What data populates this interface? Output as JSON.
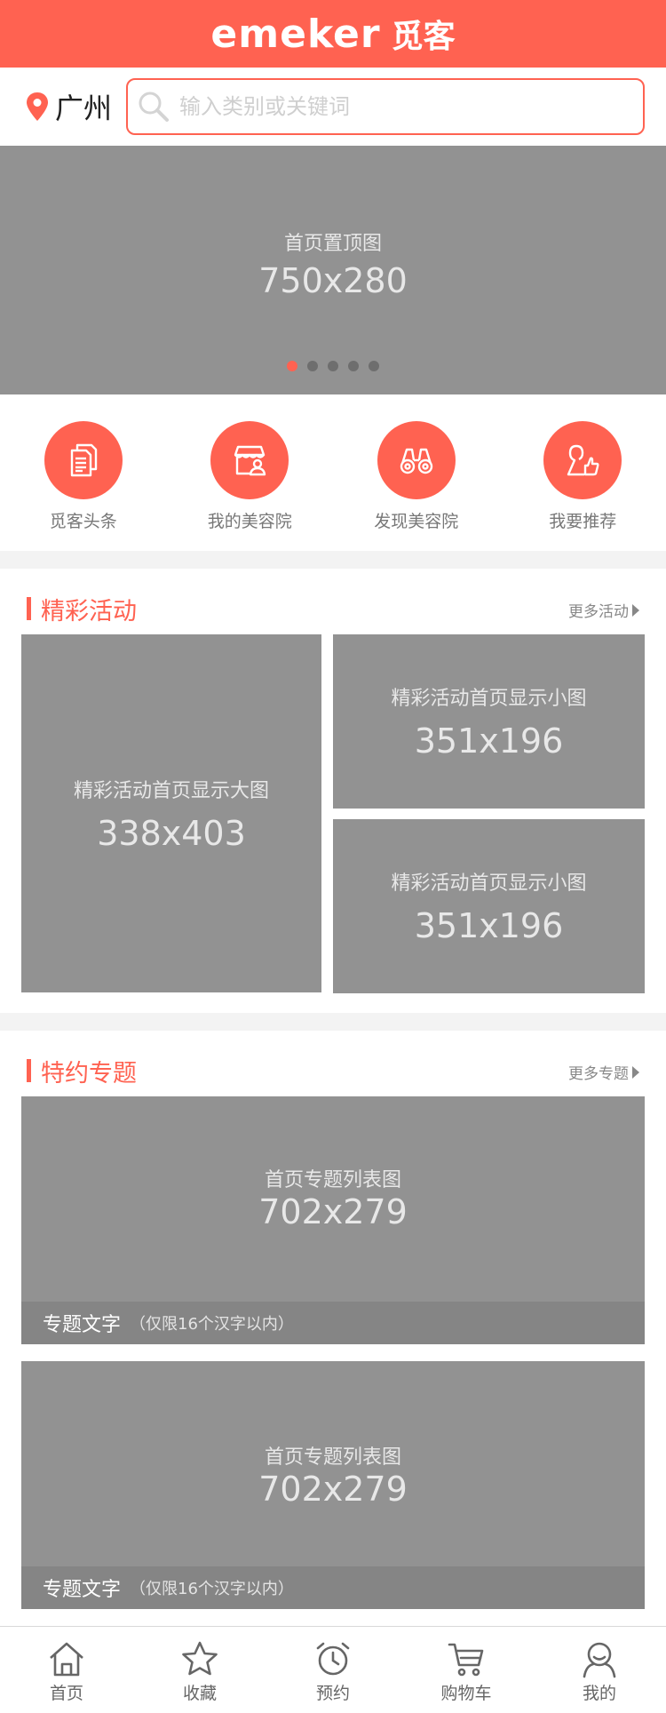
{
  "header": {
    "brand_latin": "emeker",
    "brand_cn": "觅客"
  },
  "search": {
    "city": "广州",
    "placeholder": "输入类别或关键词"
  },
  "banner": {
    "label": "首页置顶图",
    "size": "750x280",
    "dots": 5,
    "active_dot": 0
  },
  "categories": [
    {
      "label": "觅客头条",
      "icon": "document-icon"
    },
    {
      "label": "我的美容院",
      "icon": "storefront-icon"
    },
    {
      "label": "发现美容院",
      "icon": "binoculars-icon"
    },
    {
      "label": "我要推荐",
      "icon": "thumbs-up-person-icon"
    }
  ],
  "activities": {
    "title": "精彩活动",
    "more": "更多活动",
    "big": {
      "label": "精彩活动首页显示大图",
      "size": "338x403"
    },
    "small": [
      {
        "label": "精彩活动首页显示小图",
        "size": "351x196"
      },
      {
        "label": "精彩活动首页显示小图",
        "size": "351x196"
      }
    ]
  },
  "topics": {
    "title": "特约专题",
    "more": "更多专题",
    "items": [
      {
        "label": "首页专题列表图",
        "size": "702x279",
        "caption": "专题文字",
        "caption_note": "（仅限16个汉字以内）"
      },
      {
        "label": "首页专题列表图",
        "size": "702x279",
        "caption": "专题文字",
        "caption_note": "（仅限16个汉字以内）"
      }
    ]
  },
  "tabbar": [
    {
      "label": "首页",
      "icon": "home-icon"
    },
    {
      "label": "收藏",
      "icon": "star-icon"
    },
    {
      "label": "预约",
      "icon": "alarm-clock-icon"
    },
    {
      "label": "购物车",
      "icon": "cart-icon"
    },
    {
      "label": "我的",
      "icon": "user-icon"
    }
  ],
  "colors": {
    "accent": "#ff6251",
    "placeholder": "#929292",
    "text_muted": "#777777"
  }
}
